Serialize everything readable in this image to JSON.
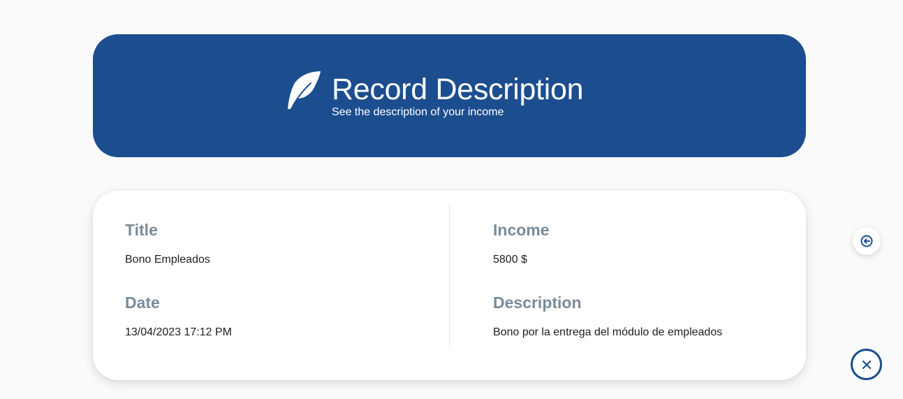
{
  "header": {
    "title": "Record Description",
    "subtitle": "See the description of your income",
    "icon": "feather-icon"
  },
  "record": {
    "title_label": "Title",
    "title_value": "Bono Empleados",
    "date_label": "Date",
    "date_value": "13/04/2023 17:12 PM",
    "income_label": "Income",
    "income_value": "5800 $",
    "description_label": "Description",
    "description_value": "Bono por la entrega del módulo de empleados"
  },
  "actions": {
    "back_icon": "circle-arrow-left-icon",
    "close_icon": "close-icon"
  },
  "colors": {
    "primary": "#1c4e8f",
    "label": "#7b8b98",
    "text": "#1d1d1d",
    "background": "#fafafa",
    "card": "#ffffff"
  }
}
